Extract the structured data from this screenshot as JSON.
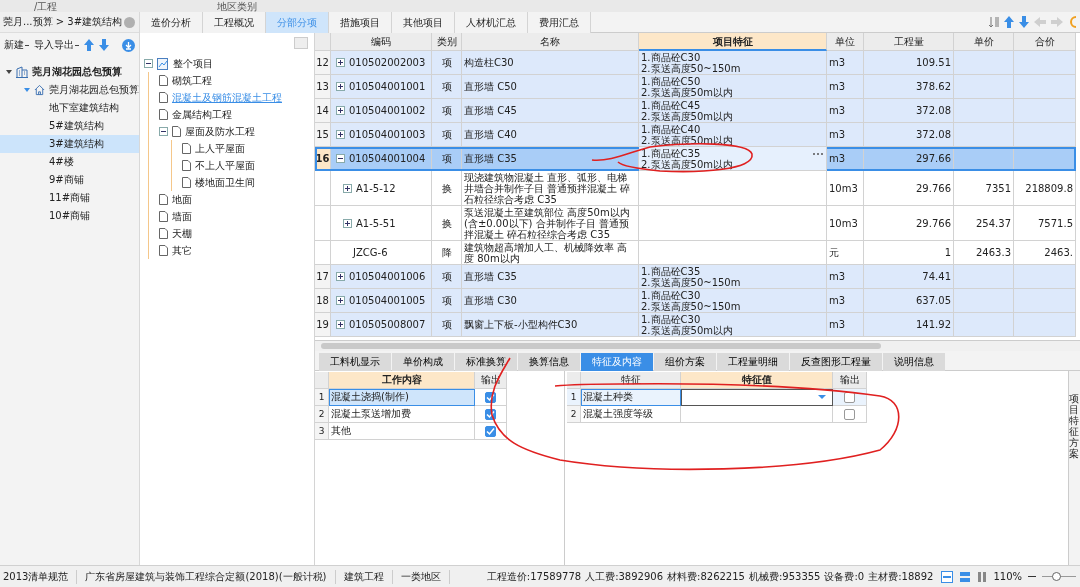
{
  "top_strip": [
    "/工程",
    "地区类别"
  ],
  "breadcrumb": "莞月...预算 > 3#建筑结构",
  "left_toolbar": [
    {
      "kind": "menu",
      "label": "新建"
    },
    {
      "kind": "menu",
      "label": "导入导出"
    },
    {
      "kind": "up"
    },
    {
      "kind": "down"
    },
    {
      "kind": "download"
    }
  ],
  "project_tree": [
    {
      "label": "莞月湖花园总包预算",
      "expanded": true,
      "selected": false,
      "children": [
        {
          "label": "莞月湖花园总包预算",
          "expanded": true,
          "selected": false,
          "children": [
            {
              "label": "地下室建筑结构",
              "selected": false
            },
            {
              "label": "5#建筑结构",
              "selected": false
            },
            {
              "label": "3#建筑结构",
              "selected": true
            },
            {
              "label": "4#楼",
              "selected": false
            },
            {
              "label": "9#商铺",
              "selected": false
            },
            {
              "label": "11#商铺",
              "selected": false
            },
            {
              "label": "10#商铺",
              "selected": false
            }
          ]
        }
      ]
    }
  ],
  "main_tabs": [
    {
      "label": "造价分析",
      "selected": false
    },
    {
      "label": "工程概况",
      "selected": false
    },
    {
      "label": "分部分项",
      "selected": true
    },
    {
      "label": "措施项目",
      "selected": false
    },
    {
      "label": "其他项目",
      "selected": false
    },
    {
      "label": "人材机汇总",
      "selected": false
    },
    {
      "label": "费用汇总",
      "selected": false
    }
  ],
  "section_tree": [
    {
      "label": "整个项目",
      "expanded": true,
      "selected": false,
      "children": [
        {
          "label": "砌筑工程",
          "selected": false
        },
        {
          "label": "混凝土及钢筋混凝土工程",
          "selected": true
        },
        {
          "label": "金属结构工程",
          "selected": false
        },
        {
          "label": "屋面及防水工程",
          "expanded": true,
          "selected": false,
          "children": [
            {
              "label": "上人平屋面",
              "selected": false
            },
            {
              "label": "不上人平屋面",
              "selected": false
            },
            {
              "label": "楼地面卫生间",
              "selected": false
            }
          ]
        },
        {
          "label": "地面",
          "selected": false
        },
        {
          "label": "墙面",
          "selected": false
        },
        {
          "label": "天棚",
          "selected": false
        },
        {
          "label": "其它",
          "selected": false
        }
      ]
    }
  ],
  "table": {
    "columns": [
      "编码",
      "类别",
      "名称",
      "项目特征",
      "单位",
      "工程量",
      "单价",
      "合价"
    ],
    "rows": [
      {
        "number": "12",
        "kind": "item",
        "expanded": false,
        "selected": false,
        "code": "010502002003",
        "type": "项",
        "name": "构造柱C30",
        "features": [
          "1.商品砼C30",
          "2.泵送高度50~150m"
        ],
        "unit": "m3",
        "quantity": "109.51"
      },
      {
        "number": "13",
        "kind": "item",
        "expanded": false,
        "selected": false,
        "code": "010504001001",
        "type": "项",
        "name": "直形墙 C50",
        "features": [
          "1.商品砼C50",
          "2.泵送高度50m以内"
        ],
        "unit": "m3",
        "quantity": "378.62"
      },
      {
        "number": "14",
        "kind": "item",
        "expanded": false,
        "selected": false,
        "code": "010504001002",
        "type": "项",
        "name": "直形墙 C45",
        "features": [
          "1.商品砼C45",
          "2.泵送高度50m以内"
        ],
        "unit": "m3",
        "quantity": "372.08"
      },
      {
        "number": "15",
        "kind": "item",
        "expanded": false,
        "selected": false,
        "code": "010504001003",
        "type": "项",
        "name": "直形墙 C40",
        "features": [
          "1.商品砼C40",
          "2.泵送高度50m以内"
        ],
        "unit": "m3",
        "quantity": "372.08"
      },
      {
        "number": "16",
        "kind": "item",
        "expanded": true,
        "selected": true,
        "code": "010504001004",
        "type": "项",
        "name": "直形墙 C35",
        "features": [
          "1.商品砼C35",
          "2.泵送高度50m以内"
        ],
        "unit": "m3",
        "quantity": "297.66",
        "children": [
          {
            "kind": "sub",
            "expanded": false,
            "code": "A1-5-12",
            "type": "换",
            "name": "现浇建筑物混凝土 直形、弧形、电梯井墙合并制作子目 普通预拌混凝土 碎石粒径综合考虑 C35",
            "unit": "10m3",
            "quantity": "29.766",
            "unit_price": "7351",
            "total": "218809.8"
          },
          {
            "kind": "sub",
            "expanded": false,
            "code": "A1-5-51",
            "type": "换",
            "name": "泵送混凝土至建筑部位 高度50m以内(含±0.00以下) 合并制作子目 普通预拌混凝土 碎石粒径综合考虑 C35",
            "unit": "10m3",
            "quantity": "29.766",
            "unit_price": "254.37",
            "total": "7571.5"
          },
          {
            "kind": "leaf",
            "code": "JZCG-6",
            "type": "降",
            "name": "建筑物超高增加人工、机械降效率 高度 80m以内",
            "unit": "元",
            "quantity": "1",
            "unit_price": "2463.3",
            "total": "2463."
          }
        ]
      },
      {
        "number": "17",
        "kind": "item",
        "expanded": false,
        "selected": false,
        "code": "010504001006",
        "type": "项",
        "name": "直形墙 C35",
        "features": [
          "1.商品砼C35",
          "2.泵送高度50~150m"
        ],
        "unit": "m3",
        "quantity": "74.41"
      },
      {
        "number": "18",
        "kind": "item",
        "expanded": false,
        "selected": false,
        "code": "010504001005",
        "type": "项",
        "name": "直形墙 C30",
        "features": [
          "1.商品砼C30",
          "2.泵送高度50~150m"
        ],
        "unit": "m3",
        "quantity": "637.05"
      },
      {
        "number": "19",
        "kind": "item",
        "expanded": false,
        "selected": false,
        "code": "010505008007",
        "type": "项",
        "name": "飘窗上下板-小型构件C30",
        "features": [
          "1.商品砼C30",
          "2.泵送高度50m以内"
        ],
        "unit": "m3",
        "quantity": "141.92"
      }
    ]
  },
  "bottom_tabs": [
    {
      "label": "工料机显示",
      "selected": false
    },
    {
      "label": "单价构成",
      "selected": false
    },
    {
      "label": "标准换算",
      "selected": false
    },
    {
      "label": "换算信息",
      "selected": false
    },
    {
      "label": "特征及内容",
      "selected": true
    },
    {
      "label": "组价方案",
      "selected": false
    },
    {
      "label": "工程量明细",
      "selected": false
    },
    {
      "label": "反查图形工程量",
      "selected": false
    },
    {
      "label": "说明信息",
      "selected": false
    }
  ],
  "work_content": {
    "columns": [
      "工作内容",
      "输出"
    ],
    "rows": [
      {
        "number": "1",
        "text": "混凝土浇捣(制作)",
        "checked": true,
        "selected": true
      },
      {
        "number": "2",
        "text": "混凝土泵送增加费",
        "checked": true,
        "selected": false
      },
      {
        "number": "3",
        "text": "其他",
        "checked": true,
        "selected": false
      }
    ]
  },
  "features_table": {
    "columns": [
      "特征",
      "特征值",
      "输出"
    ],
    "rows": [
      {
        "number": "1",
        "feature": "混凝土种类",
        "dropdown": true,
        "checked": false,
        "selected": true
      },
      {
        "number": "2",
        "feature": "混凝土强度等级",
        "dropdown": false,
        "checked": false,
        "selected": false
      }
    ]
  },
  "side_label": "项目特征方案",
  "status_bar": {
    "items": [
      "2013清单规范",
      "广东省房屋建筑与装饰工程综合定额(2018)(一般计税)",
      "建筑工程",
      "一类地区"
    ],
    "totals": [
      "工程造价:17589778",
      "人工费:3892906",
      "材料费:8262215",
      "机械费:953355",
      "设备费:0",
      "主材费:18892"
    ],
    "zoom": "110%",
    "zoom_slider": {
      "level": 0.4
    }
  }
}
